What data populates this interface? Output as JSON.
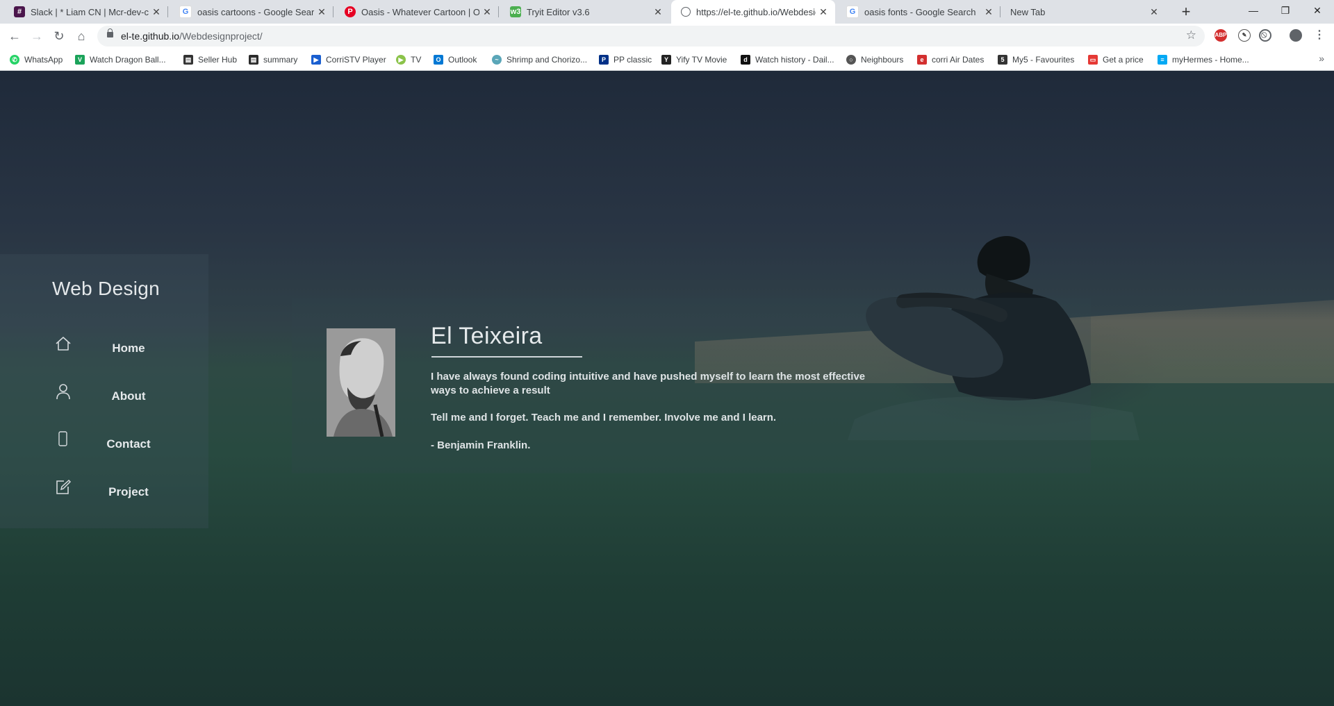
{
  "browser": {
    "tabs": [
      {
        "title": "Slack | * Liam CN | Mcr-dev-coding",
        "icon": "slack-icon",
        "color": "#4a154b"
      },
      {
        "title": "oasis cartoons - Google Search",
        "icon": "google-icon",
        "color": "#4285f4"
      },
      {
        "title": "Oasis - Whatever Cartoon | Oasis",
        "icon": "pinterest-icon",
        "color": "#e60023"
      },
      {
        "title": "Tryit Editor v3.6",
        "icon": "w3schools-icon",
        "color": "#4caf50"
      },
      {
        "title": "https://el-te.github.io/Webdesignproject/",
        "icon": "globe-icon",
        "color": "#5f6368"
      },
      {
        "title": "oasis fonts - Google Search",
        "icon": "google-icon",
        "color": "#4285f4"
      },
      {
        "title": "New Tab",
        "icon": "",
        "color": ""
      }
    ],
    "new_tab": "+",
    "window_controls": {
      "minimize": "—",
      "restore": "❐",
      "close": "✕"
    },
    "url_host": "el-te.github.io",
    "url_path": "/Webdesignproject/",
    "bookmarks": [
      {
        "label": "WhatsApp",
        "color": "#25d366"
      },
      {
        "label": "Watch Dragon Ball...",
        "color": "#1ba35a"
      },
      {
        "label": "Seller Hub",
        "color": "#333333"
      },
      {
        "label": "summary",
        "color": "#2b2b2b"
      },
      {
        "label": "CorriSTV Player",
        "color": "#1a5fd0"
      },
      {
        "label": "TV",
        "color": "#8bc34a"
      },
      {
        "label": "Outlook",
        "color": "#0078d4"
      },
      {
        "label": "Shrimp and Chorizo...",
        "color": "#5aa6b8"
      },
      {
        "label": "PP classic",
        "color": "#003087"
      },
      {
        "label": "Yify TV Movie",
        "color": "#222222"
      },
      {
        "label": "Watch history - Dail...",
        "color": "#111111"
      },
      {
        "label": "Neighbours",
        "color": "#555555"
      },
      {
        "label": "corri Air Dates",
        "color": "#d32f2f"
      },
      {
        "label": "My5 - Favourites",
        "color": "#333333"
      },
      {
        "label": "Get a price",
        "color": "#e53935"
      },
      {
        "label": "myHermes - Home...",
        "color": "#03a9f4"
      }
    ]
  },
  "site": {
    "brand": "Web Design",
    "nav": [
      {
        "label": "Home",
        "icon": "home-icon"
      },
      {
        "label": "About",
        "icon": "user-icon"
      },
      {
        "label": "Contact",
        "icon": "phone-icon"
      },
      {
        "label": "Project",
        "icon": "edit-icon"
      }
    ],
    "profile": {
      "name": "El Teixeira",
      "bio": "I have always found coding intuitive and have pushed myself to learn the most effective ways to achieve a result",
      "quote": "Tell me and I forget. Teach me and I remember. Involve me and I learn.",
      "author": "- Benjamin Franklin."
    }
  }
}
